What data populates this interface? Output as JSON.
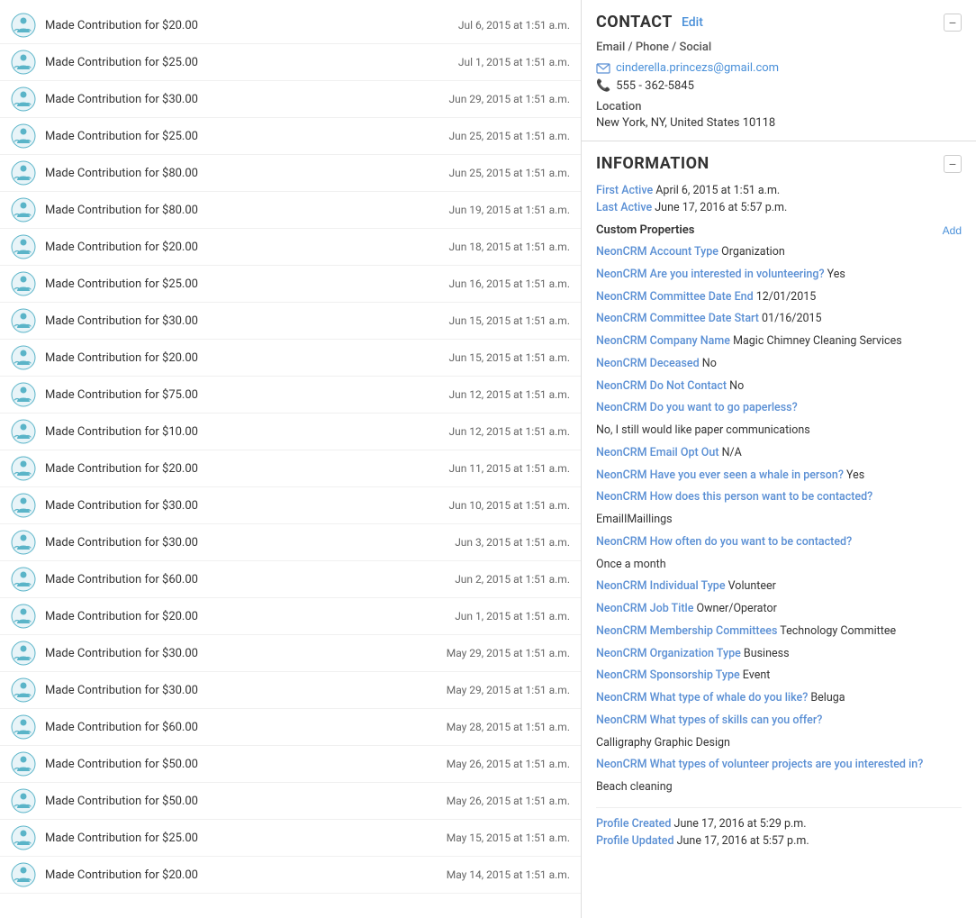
{
  "activities": [
    {
      "text": "Made Contribution for $20.00",
      "date": "Jul 6, 2015 at 1:51 a.m."
    },
    {
      "text": "Made Contribution for $25.00",
      "date": "Jul 1, 2015 at 1:51 a.m."
    },
    {
      "text": "Made Contribution for $30.00",
      "date": "Jun 29, 2015 at 1:51 a.m."
    },
    {
      "text": "Made Contribution for $25.00",
      "date": "Jun 25, 2015 at 1:51 a.m."
    },
    {
      "text": "Made Contribution for $80.00",
      "date": "Jun 25, 2015 at 1:51 a.m."
    },
    {
      "text": "Made Contribution for $80.00",
      "date": "Jun 19, 2015 at 1:51 a.m."
    },
    {
      "text": "Made Contribution for $20.00",
      "date": "Jun 18, 2015 at 1:51 a.m."
    },
    {
      "text": "Made Contribution for $25.00",
      "date": "Jun 16, 2015 at 1:51 a.m."
    },
    {
      "text": "Made Contribution for $30.00",
      "date": "Jun 15, 2015 at 1:51 a.m."
    },
    {
      "text": "Made Contribution for $20.00",
      "date": "Jun 15, 2015 at 1:51 a.m."
    },
    {
      "text": "Made Contribution for $75.00",
      "date": "Jun 12, 2015 at 1:51 a.m."
    },
    {
      "text": "Made Contribution for $10.00",
      "date": "Jun 12, 2015 at 1:51 a.m."
    },
    {
      "text": "Made Contribution for $20.00",
      "date": "Jun 11, 2015 at 1:51 a.m."
    },
    {
      "text": "Made Contribution for $30.00",
      "date": "Jun 10, 2015 at 1:51 a.m."
    },
    {
      "text": "Made Contribution for $30.00",
      "date": "Jun 3, 2015 at 1:51 a.m."
    },
    {
      "text": "Made Contribution for $60.00",
      "date": "Jun 2, 2015 at 1:51 a.m."
    },
    {
      "text": "Made Contribution for $20.00",
      "date": "Jun 1, 2015 at 1:51 a.m."
    },
    {
      "text": "Made Contribution for $30.00",
      "date": "May 29, 2015 at 1:51 a.m."
    },
    {
      "text": "Made Contribution for $30.00",
      "date": "May 29, 2015 at 1:51 a.m."
    },
    {
      "text": "Made Contribution for $60.00",
      "date": "May 28, 2015 at 1:51 a.m."
    },
    {
      "text": "Made Contribution for $50.00",
      "date": "May 26, 2015 at 1:51 a.m."
    },
    {
      "text": "Made Contribution for $50.00",
      "date": "May 26, 2015 at 1:51 a.m."
    },
    {
      "text": "Made Contribution for $25.00",
      "date": "May 15, 2015 at 1:51 a.m."
    },
    {
      "text": "Made Contribution for $20.00",
      "date": "May 14, 2015 at 1:51 a.m."
    }
  ],
  "contact": {
    "title": "CONTACT",
    "edit_label": "Edit",
    "subtitle": "Email / Phone / Social",
    "email": "cinderella.princezs@gmail.com",
    "phone": "555 - 362-5845",
    "location_label": "Location",
    "location": "New York, NY, United States 10118"
  },
  "information": {
    "title": "INFORMATION",
    "first_active_label": "First Active",
    "first_active": "April 6, 2015 at 1:51 a.m.",
    "last_active_label": "Last Active",
    "last_active": "June 17, 2016 at 5:57 p.m.",
    "custom_props_title": "Custom Properties",
    "add_label": "Add",
    "properties": [
      {
        "label": "NeonCRM Account Type",
        "value": "Organization"
      },
      {
        "label": "NeonCRM Are you interested in volunteering?",
        "value": "Yes"
      },
      {
        "label": "NeonCRM Committee Date End",
        "value": "12/01/2015"
      },
      {
        "label": "NeonCRM Committee Date Start",
        "value": "01/16/2015"
      },
      {
        "label": "NeonCRM Company Name",
        "value": "Magic Chimney Cleaning Services"
      },
      {
        "label": "NeonCRM Deceased",
        "value": "No"
      },
      {
        "label": "NeonCRM Do Not Contact",
        "value": "No"
      },
      {
        "label": "NeonCRM Do you want to go paperless?",
        "value": ""
      },
      {
        "label": "",
        "value": "No, I still would like paper communications"
      },
      {
        "label": "NeonCRM Email Opt Out",
        "value": "N/A"
      },
      {
        "label": "NeonCRM Have you ever seen a whale in person?",
        "value": "Yes"
      },
      {
        "label": "NeonCRM How does this person want to be contacted?",
        "value": ""
      },
      {
        "label": "",
        "value": "EmailIMaillings"
      },
      {
        "label": "NeonCRM How often do you want to be contacted?",
        "value": ""
      },
      {
        "label": "",
        "value": "Once a month"
      },
      {
        "label": "NeonCRM Individual Type",
        "value": "Volunteer"
      },
      {
        "label": "NeonCRM Job Title",
        "value": "Owner/Operator"
      },
      {
        "label": "NeonCRM Membership Committees",
        "value": "Technology Committee"
      },
      {
        "label": "NeonCRM Organization Type",
        "value": "Business"
      },
      {
        "label": "NeonCRM Sponsorship Type",
        "value": "Event"
      },
      {
        "label": "NeonCRM What type of whale do you like?",
        "value": "Beluga"
      },
      {
        "label": "NeonCRM What types of skills can you offer?",
        "value": ""
      },
      {
        "label": "",
        "value": "Calligraphy Graphic Design"
      },
      {
        "label": "NeonCRM What types of volunteer projects are you interested in?",
        "value": ""
      },
      {
        "label": "",
        "value": "Beach cleaning"
      }
    ],
    "profile_created_label": "Profile Created",
    "profile_created": "June 17, 2016 at 5:29 p.m.",
    "profile_updated_label": "Profile Updated",
    "profile_updated": "June 17, 2016 at 5:57 p.m."
  }
}
